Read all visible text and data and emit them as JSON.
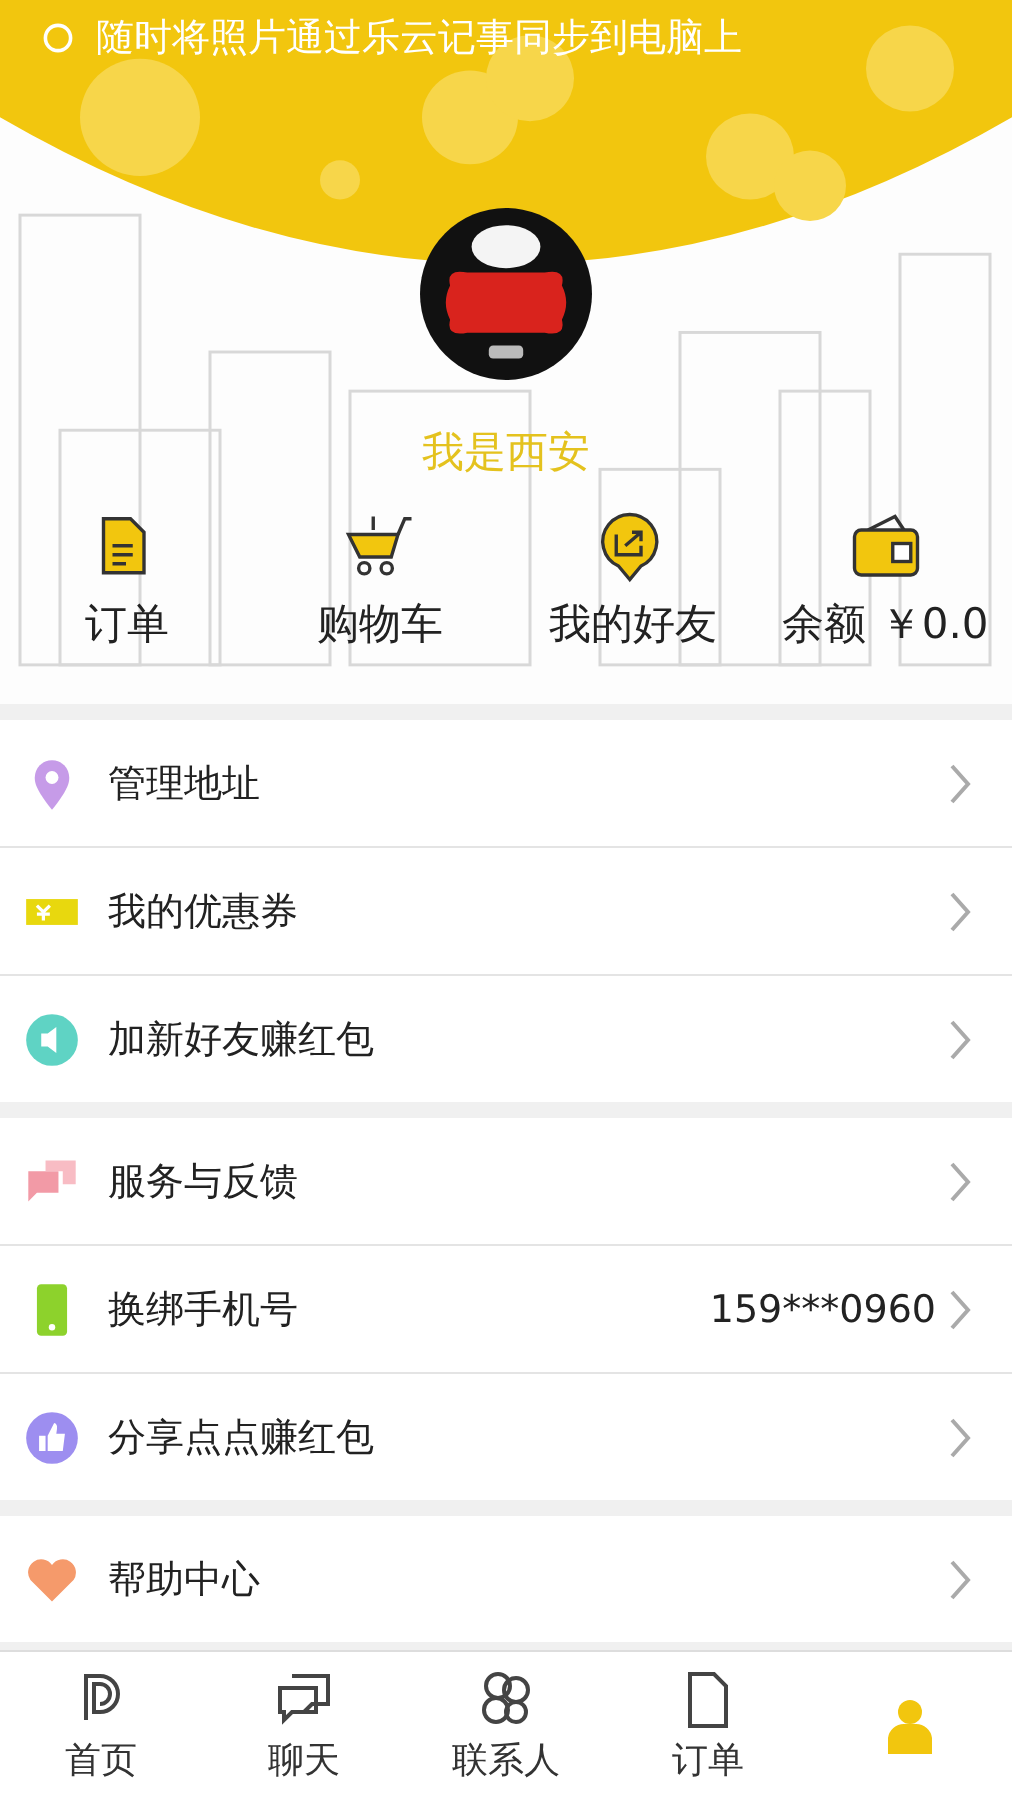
{
  "notification": {
    "text": "随时将照片通过乐云记事同步到电脑上"
  },
  "profile": {
    "name": "我是西安"
  },
  "shortcuts": [
    {
      "kind": "order",
      "label": "订单"
    },
    {
      "kind": "cart",
      "label": "购物车"
    },
    {
      "kind": "friends",
      "label": "我的好友"
    },
    {
      "kind": "wallet",
      "label": "余额 ￥0.0"
    }
  ],
  "menu_groups": [
    [
      {
        "kind": "location",
        "label": "管理地址"
      },
      {
        "kind": "coupon",
        "label": "我的优惠券"
      },
      {
        "kind": "speaker",
        "label": "加新好友赚红包"
      }
    ],
    [
      {
        "kind": "chat",
        "label": "服务与反馈"
      },
      {
        "kind": "phone",
        "label": "换绑手机号",
        "value": "159***0960"
      },
      {
        "kind": "like",
        "label": "分享点点赚红包"
      }
    ],
    [
      {
        "kind": "heart",
        "label": "帮助中心"
      }
    ]
  ],
  "tab_bar": [
    {
      "kind": "home",
      "label": "首页",
      "selected": false
    },
    {
      "kind": "chat",
      "label": "聊天",
      "selected": false
    },
    {
      "kind": "contacts",
      "label": "联系人",
      "selected": false
    },
    {
      "kind": "order",
      "label": "订单",
      "selected": false
    },
    {
      "kind": "me",
      "selected": true
    }
  ]
}
